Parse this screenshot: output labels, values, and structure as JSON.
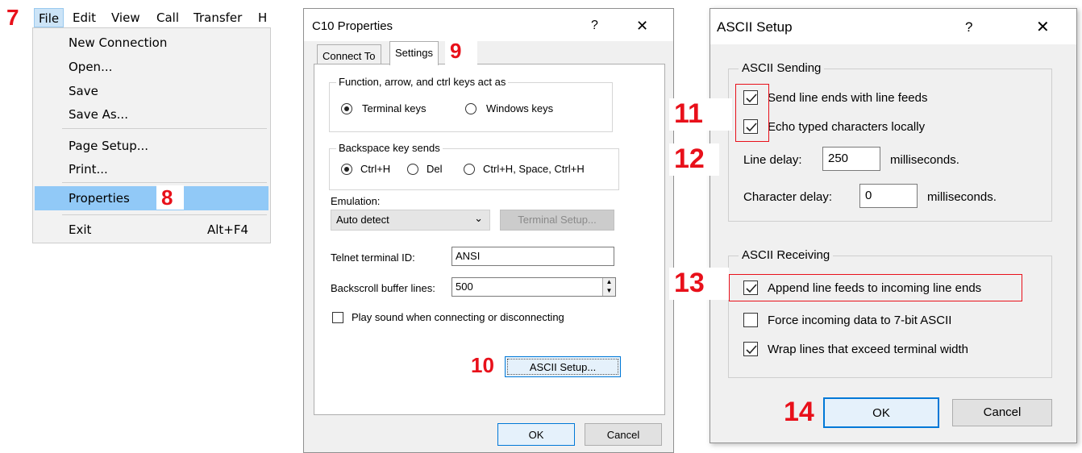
{
  "steps": {
    "s7": "7",
    "s8": "8",
    "s9": "9",
    "s10": "10",
    "s11": "11",
    "s12": "12",
    "s13": "13",
    "s14": "14"
  },
  "colors": {
    "step": "#e8101a",
    "highlight": "#91c9f7",
    "accent": "#0078d7"
  },
  "menubar": {
    "items": [
      "File",
      "Edit",
      "View",
      "Call",
      "Transfer",
      "H"
    ]
  },
  "file_menu": {
    "items": [
      {
        "label": "New Connection"
      },
      {
        "label": "Open..."
      },
      {
        "label": "Save"
      },
      {
        "label": "Save As..."
      },
      {
        "label": "Page Setup..."
      },
      {
        "label": "Print..."
      },
      {
        "label": "Properties",
        "highlighted": true
      },
      {
        "label": "Exit",
        "shortcut": "Alt+F4"
      }
    ]
  },
  "properties_dialog": {
    "title": "C10 Properties",
    "help": "?",
    "close": "✕",
    "tabs": [
      "Connect To",
      "Settings"
    ],
    "active_tab": "Settings",
    "keys_group": {
      "label": "Function, arrow, and ctrl keys act as",
      "options": [
        "Terminal keys",
        "Windows keys"
      ],
      "selected": "Terminal keys"
    },
    "backspace_group": {
      "label": "Backspace key sends",
      "options": [
        "Ctrl+H",
        "Del",
        "Ctrl+H, Space, Ctrl+H"
      ],
      "selected": "Ctrl+H"
    },
    "emulation": {
      "label": "Emulation:",
      "value": "Auto detect",
      "setup_button": "Terminal Setup..."
    },
    "telnet": {
      "label": "Telnet terminal ID:",
      "value": "ANSI"
    },
    "backscroll": {
      "label": "Backscroll buffer lines:",
      "value": "500"
    },
    "sound": {
      "label": "Play sound when connecting or disconnecting",
      "checked": false
    },
    "ascii_setup_button": "ASCII Setup...",
    "ok": "OK",
    "cancel": "Cancel"
  },
  "ascii_dialog": {
    "title": "ASCII Setup",
    "help": "?",
    "close": "✕",
    "sending": {
      "label": "ASCII Sending",
      "line_ends": {
        "label": "Send line ends with line feeds",
        "checked": true
      },
      "echo": {
        "label": "Echo typed characters locally",
        "checked": true
      },
      "line_delay": {
        "label": "Line delay:",
        "value": "250",
        "unit": "milliseconds."
      },
      "char_delay": {
        "label": "Character delay:",
        "value": "0",
        "unit": "milliseconds."
      }
    },
    "receiving": {
      "label": "ASCII Receiving",
      "append": {
        "label": "Append line feeds to incoming line ends",
        "checked": true
      },
      "force7": {
        "label": "Force incoming data to 7-bit ASCII",
        "checked": false
      },
      "wrap": {
        "label": "Wrap lines that exceed terminal width",
        "checked": true
      }
    },
    "ok": "OK",
    "cancel": "Cancel"
  }
}
